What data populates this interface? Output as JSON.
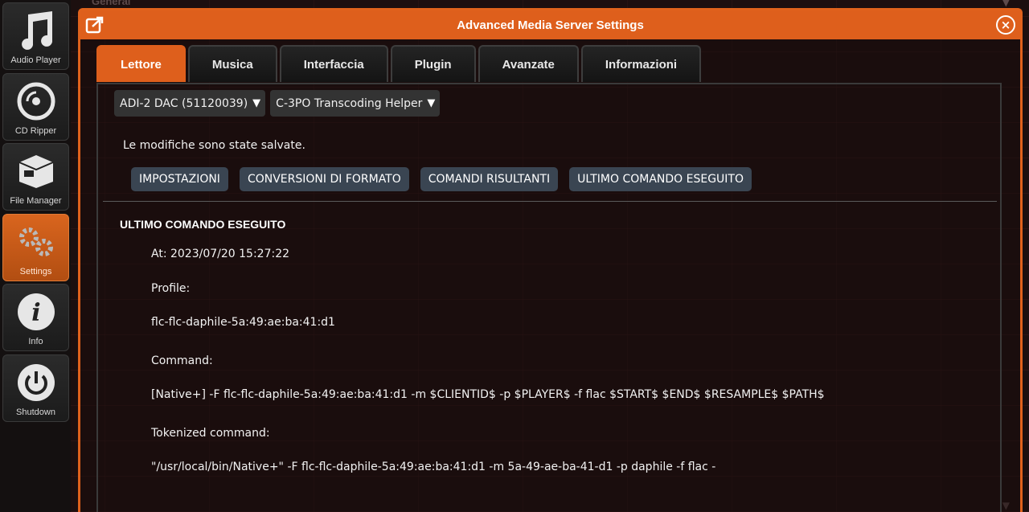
{
  "underlay": {
    "title": "General"
  },
  "sidebar": {
    "items": [
      {
        "label": "Audio Player",
        "icon": "music-note-icon",
        "active": false
      },
      {
        "label": "CD Ripper",
        "icon": "disc-icon",
        "active": false
      },
      {
        "label": "File Manager",
        "icon": "box-icon",
        "active": false
      },
      {
        "label": "Settings",
        "icon": "gears-icon",
        "active": true
      },
      {
        "label": "Info",
        "icon": "info-icon",
        "active": false
      },
      {
        "label": "Shutdown",
        "icon": "power-icon",
        "active": false
      }
    ]
  },
  "dialog": {
    "title": "Advanced Media Server Settings",
    "tabs": [
      {
        "label": "Lettore",
        "active": true
      },
      {
        "label": "Musica",
        "active": false
      },
      {
        "label": "Interfaccia",
        "active": false
      },
      {
        "label": "Plugin",
        "active": false
      },
      {
        "label": "Avanzate",
        "active": false
      },
      {
        "label": "Informazioni",
        "active": false
      }
    ],
    "player_select": "ADI-2 DAC (51120039)",
    "plugin_select": "C-3PO Transcoding Helper",
    "saved_message": "Le modifiche sono state salvate.",
    "sub_buttons": [
      "IMPOSTAZIONI",
      "CONVERSIONI DI FORMATO",
      "COMANDI RISULTANTI",
      "ULTIMO COMANDO ESEGUITO"
    ],
    "section_title": "ULTIMO COMANDO ESEGUITO",
    "details": {
      "at": "At: 2023/07/20 15:27:22",
      "profile_label": "Profile:",
      "profile_value": "flc-flc-daphile-5a:49:ae:ba:41:d1",
      "command_label": "Command:",
      "command_value": "[Native+] -F flc-flc-daphile-5a:49:ae:ba:41:d1 -m $CLIENTID$ -p $PLAYER$ -f flac $START$ $END$ $RESAMPLE$ $PATH$",
      "tokenized_label": "Tokenized command:",
      "tokenized_value": "\"/usr/local/bin/Native+\" -F flc-flc-daphile-5a:49:ae:ba:41:d1 -m 5a-49-ae-ba-41-d1 -p daphile -f flac -"
    }
  },
  "colors": {
    "accent": "#de5f1c",
    "sub_button_bg": "#3a4552",
    "background": "#1c0f0f"
  }
}
